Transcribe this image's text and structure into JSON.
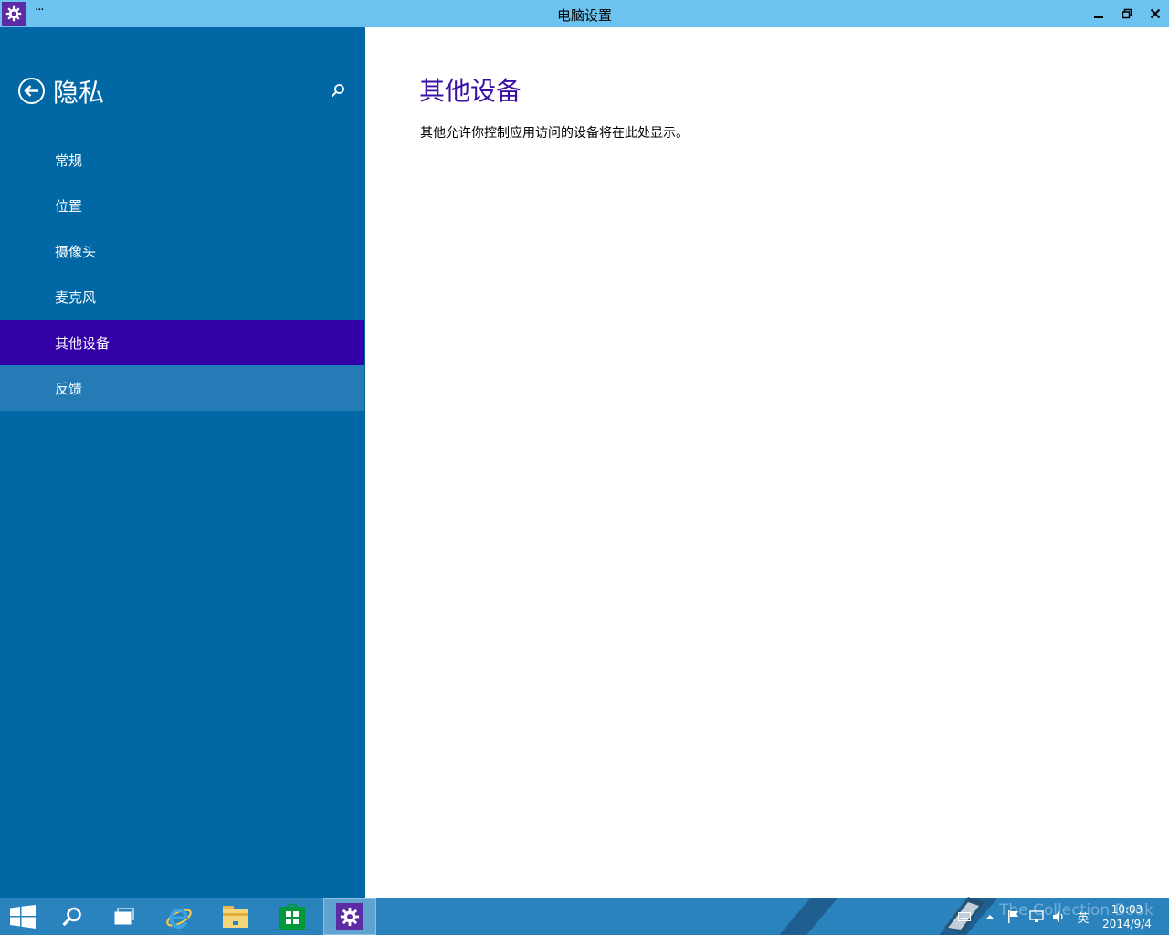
{
  "window": {
    "title": "电脑设置",
    "menu_label": "···",
    "app_icon": "gear-icon",
    "controls": [
      "minimize-icon",
      "restore-icon",
      "close-icon"
    ]
  },
  "sidebar": {
    "title": "隐私",
    "back_icon": "back-arrow-icon",
    "search_icon": "search-icon",
    "items": [
      {
        "label": "常规",
        "state": "normal"
      },
      {
        "label": "位置",
        "state": "normal"
      },
      {
        "label": "摄像头",
        "state": "normal"
      },
      {
        "label": "麦克风",
        "state": "normal"
      },
      {
        "label": "其他设备",
        "state": "selected"
      },
      {
        "label": "反馈",
        "state": "hover"
      }
    ]
  },
  "content": {
    "heading": "其他设备",
    "description": "其他允许你控制应用访问的设备将在此处显示。"
  },
  "taskbar": {
    "buttons": [
      "start-icon",
      "search-icon",
      "task-view-icon",
      "internet-explorer-icon",
      "file-explorer-icon",
      "store-icon",
      "settings-icon"
    ],
    "active": "settings-icon",
    "tray_icons": [
      "keyboard-icon",
      "show-hidden-icon",
      "action-center-flag-icon",
      "network-icon",
      "volume-icon"
    ],
    "input_language": "英",
    "time": "10:03",
    "date": "2014/9/4",
    "watermark": "The Collection Book"
  },
  "colors": {
    "titlebar": "#6cc3ef",
    "sidebar": "#0168a5",
    "selected": "#3300a8",
    "hover": "#247bb5",
    "heading": "#3a0fa6",
    "taskbar": "#2a83bd"
  }
}
